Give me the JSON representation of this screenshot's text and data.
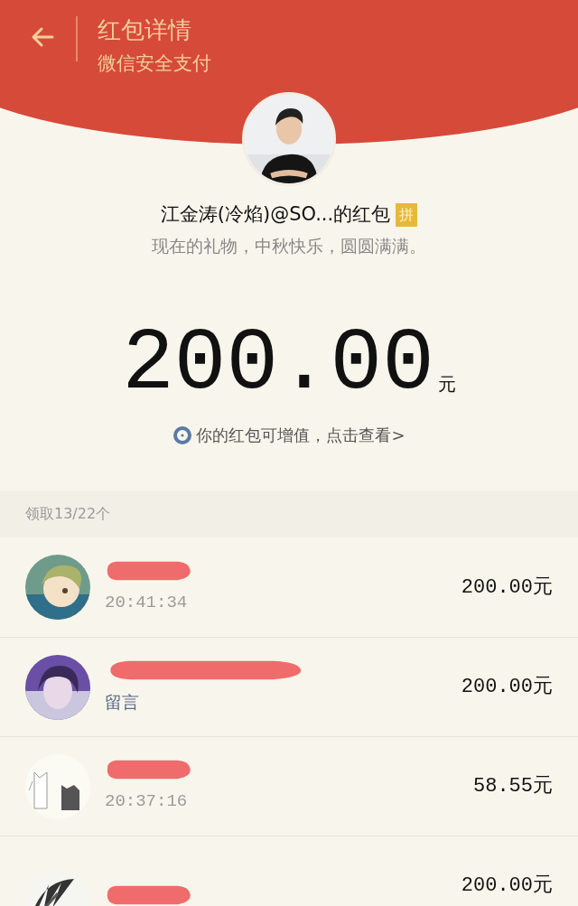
{
  "header": {
    "title": "红包详情",
    "subtitle": "微信安全支付"
  },
  "sender": {
    "name": "江金涛(冷焰)@SO...的红包",
    "badge": "拼",
    "greeting": "现在的礼物，中秋快乐，圆圆满满。"
  },
  "amount": {
    "value": "200.00",
    "unit": "元"
  },
  "link": "你的红包可增值，点击查看>",
  "summary": "领取13/22个",
  "recipients": [
    {
      "name_redacted": true,
      "kind": "time",
      "detail": "20:41:34",
      "amount": "200.00元"
    },
    {
      "name_redacted": true,
      "kind": "message",
      "detail": "留言",
      "amount": "200.00元"
    },
    {
      "name_redacted": true,
      "kind": "time",
      "detail": "20:37:16",
      "amount": "58.55元"
    },
    {
      "name_redacted": true,
      "amount": "200.00元"
    }
  ]
}
